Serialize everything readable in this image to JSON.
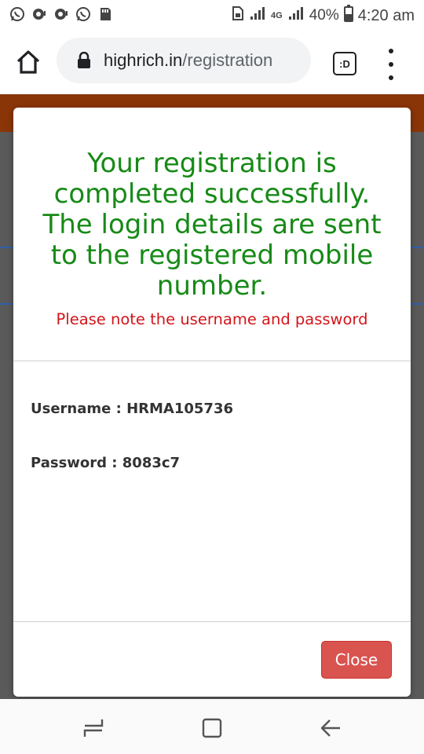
{
  "status_bar": {
    "left_icons": [
      "whatsapp-icon",
      "chat-bubble-icon",
      "chat-bubble-icon",
      "whatsapp-icon",
      "sd-card-icon"
    ],
    "battery": "40%",
    "time": "4:20 am",
    "network": "4G"
  },
  "browser": {
    "url_host": "highrich.in",
    "url_path": "/registration",
    "tabs_label": ":D"
  },
  "modal": {
    "success_message": "Your registration is completed successfully. The login details are sent to the registered mobile number.",
    "note": "Please note the username and password",
    "username_label": "Username : ",
    "username": "HRMA105736",
    "password_label": "Password : ",
    "password": "8083c7",
    "close_label": "Close"
  },
  "colors": {
    "success": "#178a17",
    "note": "#d3151a",
    "close_button": "#d9534f",
    "page_header": "#8a3508"
  }
}
